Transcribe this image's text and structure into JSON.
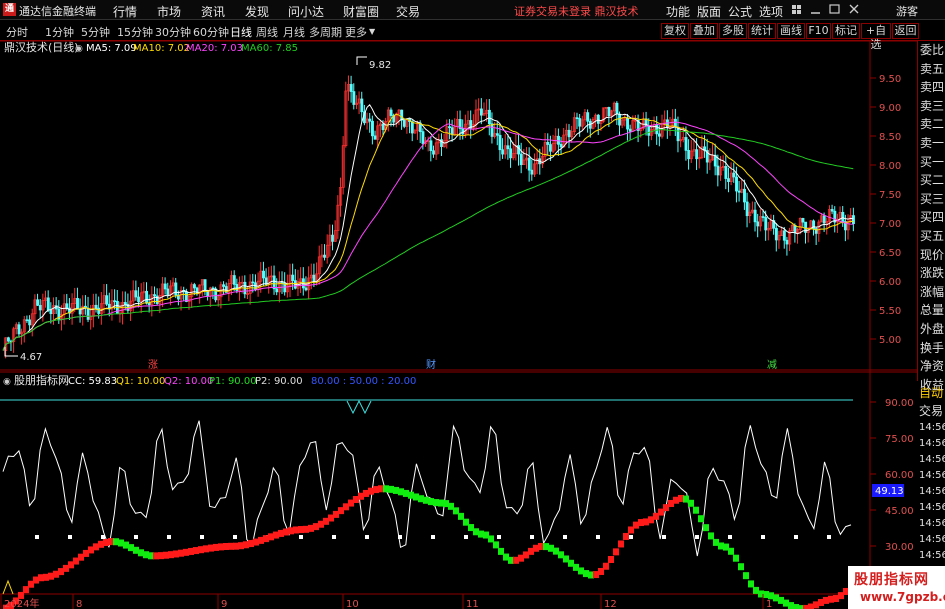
{
  "menubar": {
    "app_name": "通达信金融终端",
    "items": [
      "行情",
      "市场",
      "资讯",
      "发现",
      "问小达",
      "财富圈",
      "交易"
    ],
    "notice": "证券交易未登录  鼎汉技术",
    "right_items": [
      "功能",
      "版面",
      "公式",
      "选项"
    ],
    "guest": "游客"
  },
  "toolbar": {
    "periods": [
      "分时",
      "1分钟",
      "5分钟",
      "15分钟",
      "30分钟",
      "60分钟",
      "日线",
      "周线",
      "月线",
      "多周期",
      "更多"
    ],
    "active_period": "日线",
    "right_buttons": [
      "复权",
      "叠加",
      "多股",
      "统计",
      "画线",
      "F10",
      "标记",
      "+自选",
      "返回"
    ]
  },
  "main_chart": {
    "stock_label": "鼎汉技术(日线)",
    "ma": [
      {
        "label": "MA5: 7.09",
        "color": "#ffffff"
      },
      {
        "label": "MA10: 7.02",
        "color": "#ffdd00"
      },
      {
        "label": "MA20: 7.03",
        "color": "#ff44ff"
      },
      {
        "label": "MA60: 7.85",
        "color": "#22cc22"
      }
    ],
    "price_ticks": [
      "9.50",
      "9.00",
      "8.50",
      "8.00",
      "7.50",
      "7.00",
      "6.50",
      "6.00",
      "5.50",
      "5.00"
    ],
    "high_label": "9.82",
    "low_label": "4.67",
    "event_markers": [
      {
        "text": "涨",
        "color": "#ff4444"
      },
      {
        "text": "财",
        "color": "#5599ff"
      },
      {
        "text": "减",
        "color": "#44dd44"
      }
    ]
  },
  "indicator": {
    "name": "股朋指标网",
    "values": [
      {
        "label": "CC: 59.83",
        "color": "#ffffff"
      },
      {
        "label": "Q1: 10.00",
        "color": "#ffdd00"
      },
      {
        "label": "Q2: 10.00",
        "color": "#ff44ff"
      },
      {
        "label": "P1: 90.00",
        "color": "#22dd22"
      },
      {
        "label": "P2: 90.00",
        "color": "#dddddd"
      },
      {
        "label": "80.00 : 50.00 : 20.00",
        "color": "#3355ff"
      }
    ],
    "ticks": [
      "90.00",
      "75.00",
      "60.00",
      "45.00",
      "30.00"
    ],
    "current_value": "49.13"
  },
  "right_panel": {
    "items": [
      "委比",
      "卖五",
      "卖四",
      "卖三",
      "卖二",
      "卖一",
      "买一",
      "买二",
      "买三",
      "买四",
      "买五",
      "现价",
      "涨跌",
      "涨幅",
      "总量",
      "外盘",
      "换手",
      "净资",
      "收益"
    ],
    "auto_label": "自动",
    "trade_label": "交易",
    "times": [
      "14:56",
      "14:56",
      "14:56",
      "14:56",
      "14:56",
      "14:56",
      "14:56",
      "14:56",
      "14:56",
      "14:56"
    ]
  },
  "x_axis": {
    "labels": [
      "2024年",
      "8",
      "9",
      "10",
      "11",
      "12",
      "1"
    ]
  },
  "watermark": {
    "title": "股朋指标网",
    "url": "www.7gpzb.com"
  },
  "colors": {
    "up": "#ff3232",
    "down": "#54ffff",
    "frame": "#8b0000",
    "bull": "#ff1a1a",
    "bear": "#10ee10"
  }
}
